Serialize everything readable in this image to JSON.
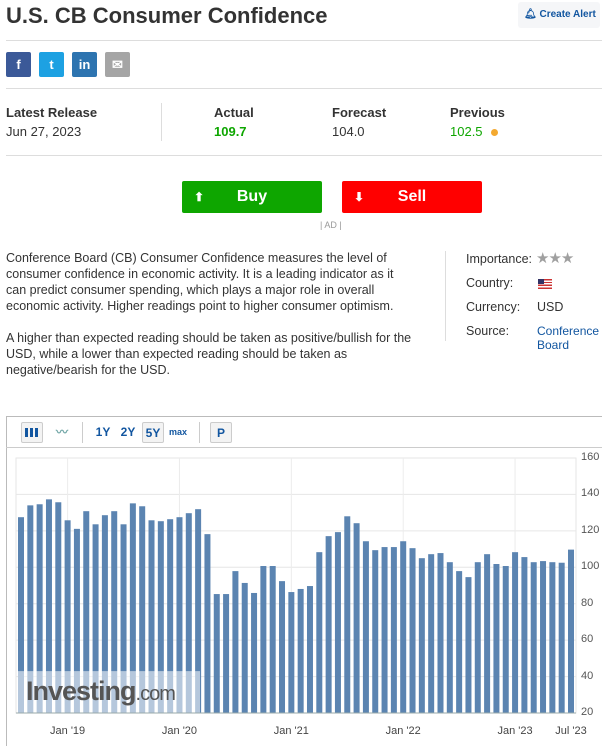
{
  "header": {
    "title": "U.S. CB Consumer Confidence",
    "alert_label": "Create Alert"
  },
  "share": [
    {
      "name": "facebook",
      "glyph": "f",
      "color": "#3b5998"
    },
    {
      "name": "twitter",
      "glyph": "t",
      "color": "#1da1e2"
    },
    {
      "name": "linkedin",
      "glyph": "in",
      "color": "#2d74b0"
    },
    {
      "name": "email",
      "glyph": "✉",
      "color": "#a5a5a5"
    }
  ],
  "release": {
    "latest_label": "Latest Release",
    "latest_value": "Jun 27, 2023",
    "actual_label": "Actual",
    "actual_value": "109.7",
    "forecast_label": "Forecast",
    "forecast_value": "104.0",
    "previous_label": "Previous",
    "previous_value": "102.5"
  },
  "colors": {
    "positive": "#0ea600",
    "buy": "#0ea600",
    "sell": "#ff0000",
    "bar": "#5b84b1",
    "revised_dot": "#f3a930",
    "link": "#1256a0"
  },
  "ad": {
    "buy_label": "Buy",
    "sell_label": "Sell",
    "ad_label": "| AD |"
  },
  "description": {
    "p1": "Conference Board (CB) Consumer Confidence measures the level of consumer confidence in economic activity. It is a leading indicator as it can predict consumer spending, which plays a major role in overall economic activity. Higher readings point to higher consumer optimism.",
    "p2": "A higher than expected reading should be taken as positive/bullish for the USD, while a lower than expected reading should be taken as negative/bearish for the USD."
  },
  "info": {
    "importance_label": "Importance:",
    "importance_stars": 3,
    "country_label": "Country:",
    "currency_label": "Currency:",
    "currency_value": "USD",
    "source_label": "Source:",
    "source_value": "Conference Board"
  },
  "toolbar": {
    "ranges": [
      "1Y",
      "2Y",
      "5Y",
      "max"
    ],
    "selected": "5Y",
    "p_label": "P"
  },
  "chart_data": {
    "type": "bar",
    "title": "U.S. CB Consumer Confidence",
    "ylim": [
      20,
      160
    ],
    "yticks": [
      "20",
      "40",
      "60",
      "80",
      "100",
      "120",
      "140",
      "160"
    ],
    "xtick_labels": [
      {
        "label": "Jan '19",
        "index": 5
      },
      {
        "label": "Jan '20",
        "index": 17
      },
      {
        "label": "Jan '21",
        "index": 29
      },
      {
        "label": "Jan '22",
        "index": 41
      },
      {
        "label": "Jan '23",
        "index": 53
      },
      {
        "label": "Jul '23",
        "index": 59
      }
    ],
    "x_start": "Aug 2018",
    "x_end": "Jul 2023",
    "values": [
      127.5,
      134.0,
      134.6,
      137.3,
      135.7,
      125.8,
      121.1,
      130.8,
      123.6,
      128.6,
      130.8,
      123.6,
      135.1,
      133.5,
      125.8,
      125.3,
      126.4,
      127.5,
      129.7,
      131.9,
      118.2,
      85.3,
      85.3,
      97.9,
      91.4,
      85.9,
      100.7,
      100.7,
      92.4,
      86.4,
      88.1,
      89.7,
      108.3,
      117.1,
      119.3,
      128.0,
      124.2,
      114.3,
      109.4,
      111.1,
      111.1,
      114.3,
      110.5,
      105.0,
      107.2,
      107.8,
      102.8,
      97.9,
      94.6,
      102.8,
      107.2,
      101.8,
      100.7,
      108.3,
      105.6,
      102.8,
      103.4,
      102.8,
      102.5,
      109.7
    ],
    "watermark": "Investing.com",
    "grid": true
  }
}
